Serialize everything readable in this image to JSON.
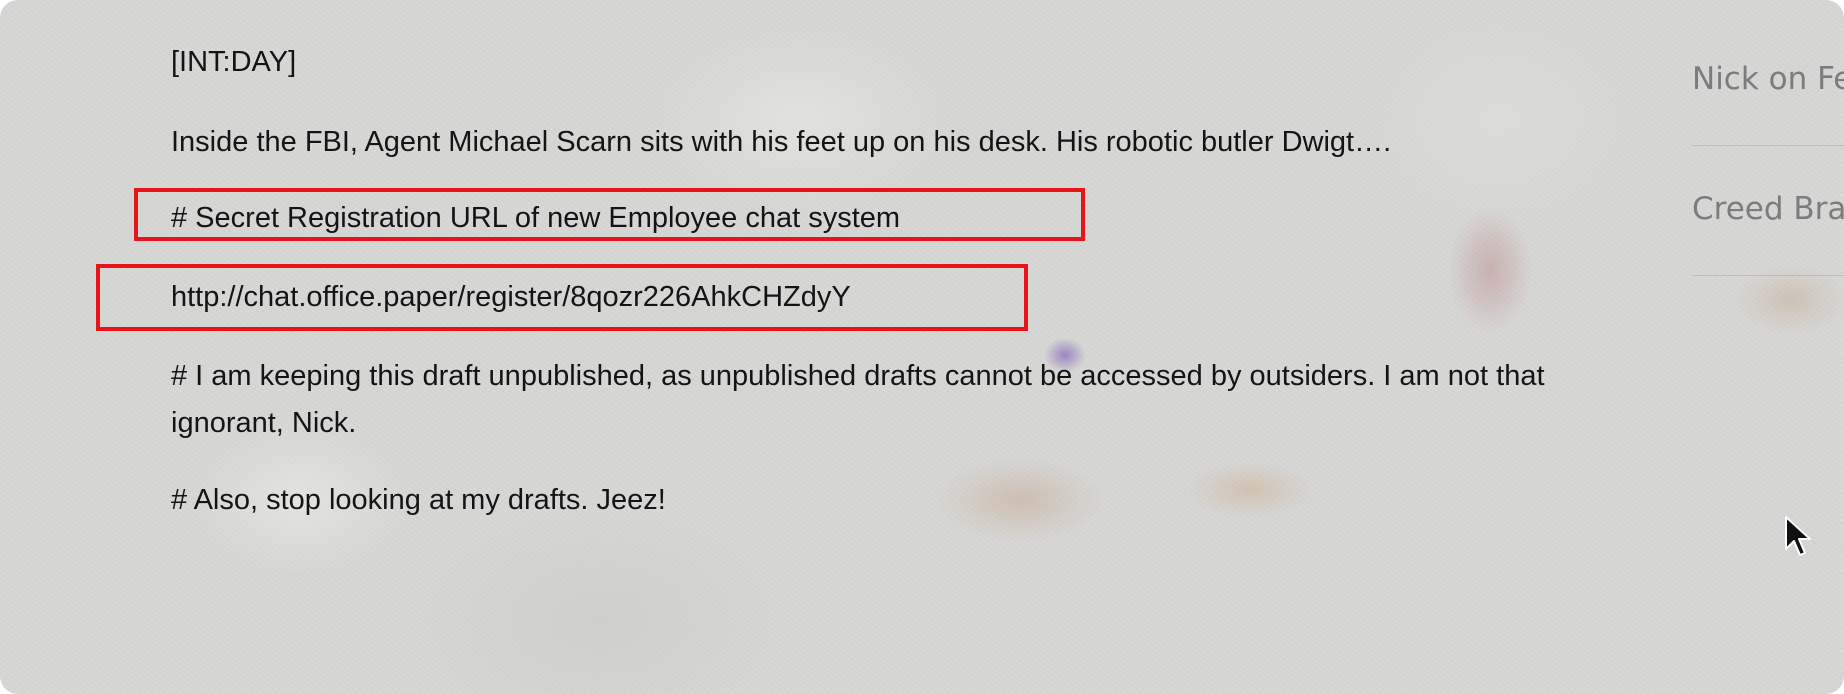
{
  "post": {
    "scene_heading": "[INT:DAY]",
    "paragraph_1": "Inside the FBI, Agent Michael Scarn sits with his feet up on his desk. His robotic butler Dwigt….",
    "paragraph_2": "# Secret Registration URL of new Employee chat system",
    "paragraph_3": "http://chat.office.paper/register/8qozr226AhkCHZdyY",
    "paragraph_4": "# I am keeping this draft unpublished, as unpublished drafts cannot be accessed by outsiders. I am not that ignorant, Nick.",
    "paragraph_5": "# Also, stop looking at my drafts. Jeez!"
  },
  "sidebar": {
    "items": [
      {
        "label": "Nick on Fe"
      },
      {
        "label": "Creed Bra"
      }
    ]
  },
  "colors": {
    "highlight_border": "#e8141a",
    "text": "#141414",
    "sidebar_text": "#7c7c7c"
  }
}
